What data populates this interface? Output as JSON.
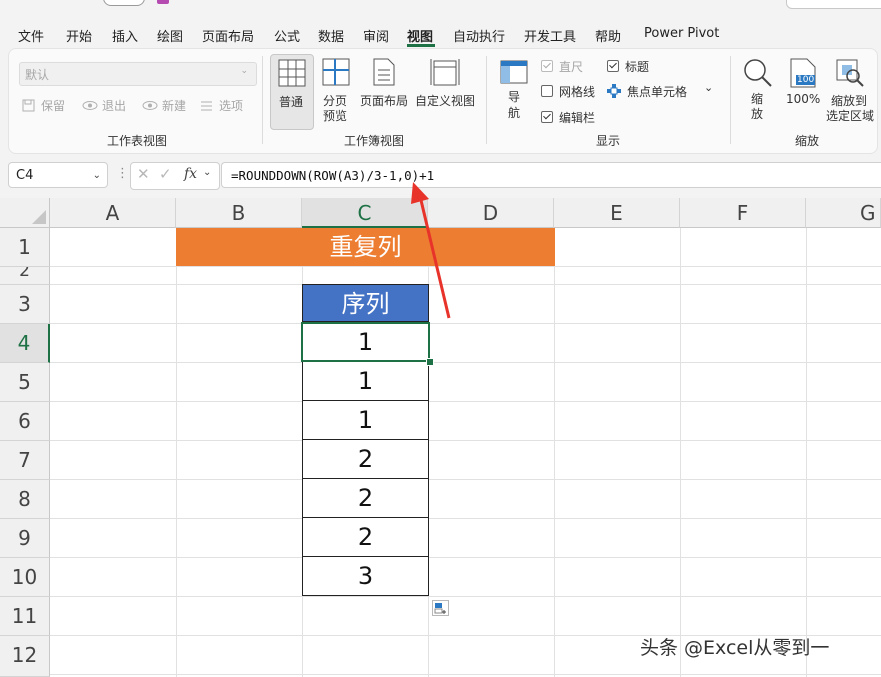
{
  "menu": {
    "tabs": [
      "文件",
      "开始",
      "插入",
      "绘图",
      "页面布局",
      "公式",
      "数据",
      "审阅",
      "视图",
      "自动执行",
      "开发工具",
      "帮助",
      "Power Pivot"
    ],
    "active_tab": "视图"
  },
  "ribbon": {
    "sheet_view": {
      "dropdown_value": "默认",
      "keep": "保留",
      "exit": "退出",
      "new": "新建",
      "options": "选项",
      "group_label": "工作表视图"
    },
    "workbook_view": {
      "normal": "普通",
      "page_break_1": "分页",
      "page_break_2": "预览",
      "page_layout": "页面布局",
      "custom_view": "自定义视图",
      "group_label": "工作簿视图"
    },
    "show": {
      "navigation_1": "导",
      "navigation_2": "航",
      "ruler": "直尺",
      "gridlines": "网格线",
      "formula_bar": "编辑栏",
      "headings": "标题",
      "focus_cell": "焦点单元格",
      "group_label": "显示"
    },
    "zoom": {
      "zoom_1": "缩",
      "zoom_2": "放",
      "hundred": "100%",
      "hundred_icon_text": "100",
      "to_selection_1": "缩放到",
      "to_selection_2": "选定区域",
      "group_label": "缩放"
    }
  },
  "formula_bar": {
    "name_box": "C4",
    "fx": "fx",
    "formula": "=ROUNDDOWN(ROW(A3)/3-1,0)+1"
  },
  "sheet": {
    "columns": [
      "A",
      "B",
      "C",
      "D",
      "E",
      "F",
      "G"
    ],
    "rows": [
      "1",
      "2",
      "3",
      "4",
      "5",
      "6",
      "7",
      "8",
      "9",
      "10",
      "11",
      "12"
    ],
    "selected_column": "C",
    "selected_row": "4",
    "banner_title": "重复列",
    "table_header": "序列",
    "values": [
      "1",
      "1",
      "1",
      "2",
      "2",
      "2",
      "3"
    ]
  },
  "watermark": "头条 @Excel从零到一",
  "colors": {
    "accent_green": "#1e7145",
    "banner_orange": "#ed7d31",
    "header_blue": "#4472c4",
    "arrow_red": "#e8332a"
  }
}
